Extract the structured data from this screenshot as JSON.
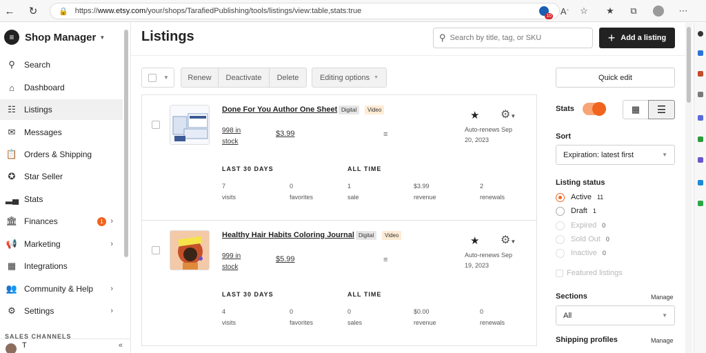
{
  "browser": {
    "url_prefix": "https://",
    "url_domain": "www.etsy.com",
    "url_path": "/your/shops/TarafiedPublishing/tools/listings/view:table,stats:true",
    "badge_count": "10"
  },
  "sidebar": {
    "title": "Shop Manager",
    "items": [
      {
        "label": "Search",
        "icon": "search-icon"
      },
      {
        "label": "Dashboard",
        "icon": "home-icon"
      },
      {
        "label": "Listings",
        "icon": "listings-icon"
      },
      {
        "label": "Messages",
        "icon": "mail-icon"
      },
      {
        "label": "Orders & Shipping",
        "icon": "clipboard-icon"
      },
      {
        "label": "Star Seller",
        "icon": "star-seller-icon"
      },
      {
        "label": "Stats",
        "icon": "bar-chart-icon"
      },
      {
        "label": "Finances",
        "icon": "bank-icon",
        "badge": "1"
      },
      {
        "label": "Marketing",
        "icon": "megaphone-icon"
      },
      {
        "label": "Integrations",
        "icon": "grid-icon"
      },
      {
        "label": "Community & Help",
        "icon": "people-icon"
      },
      {
        "label": "Settings",
        "icon": "gear-icon"
      }
    ],
    "channels_label": "SALES CHANNELS",
    "user_initial": "T"
  },
  "header": {
    "title": "Listings",
    "search_placeholder": "Search by title, tag, or SKU",
    "add_label": "Add a listing"
  },
  "toolbar": {
    "renew": "Renew",
    "deactivate": "Deactivate",
    "delete": "Delete",
    "editing": "Editing options"
  },
  "listings": [
    {
      "title": "Done For You Author One Sheet",
      "tag1": "Digital",
      "tag2": "Video",
      "stock_line1": "998 in",
      "stock_line2": "stock",
      "price": "$3.99",
      "renew_line1": "Auto-renews Sep",
      "renew_line2": "20, 2023",
      "last30": "LAST 30 DAYS",
      "alltime": "ALL TIME",
      "visits": "7",
      "visits_lbl": "visits",
      "favs": "0",
      "favs_lbl": "favorites",
      "sales": "1",
      "sales_lbl": "sale",
      "revenue": "$3.99",
      "revenue_lbl": "revenue",
      "renewals": "2",
      "renewals_lbl": "renewals"
    },
    {
      "title": "Healthy Hair Habits Coloring Journal",
      "tag1": "Digital",
      "tag2": "Video",
      "stock_line1": "999 in",
      "stock_line2": "stock",
      "price": "$5.99",
      "renew_line1": "Auto-renews Sep",
      "renew_line2": "19, 2023",
      "last30": "LAST 30 DAYS",
      "alltime": "ALL TIME",
      "visits": "4",
      "visits_lbl": "visits",
      "favs": "0",
      "favs_lbl": "favorites",
      "sales": "0",
      "sales_lbl": "sales",
      "revenue": "$0.00",
      "revenue_lbl": "revenue",
      "renewals": "0",
      "renewals_lbl": "renewals"
    }
  ],
  "panel": {
    "quick_edit": "Quick edit",
    "stats_label": "Stats",
    "stats_on": true,
    "sort_label": "Sort",
    "sort_value": "Expiration: latest first",
    "status_label": "Listing status",
    "statuses": [
      {
        "label": "Active",
        "count": "11",
        "selected": true
      },
      {
        "label": "Draft",
        "count": "1"
      },
      {
        "label": "Expired",
        "count": "0"
      },
      {
        "label": "Sold Out",
        "count": "0"
      },
      {
        "label": "Inactive",
        "count": "0"
      }
    ],
    "featured": "Featured listings",
    "sections_label": "Sections",
    "sections_manage": "Manage",
    "sections_value": "All",
    "shipping_label": "Shipping profiles",
    "shipping_manage": "Manage"
  },
  "colors": {
    "accent": "#f1641e",
    "dark_button": "#222222"
  }
}
